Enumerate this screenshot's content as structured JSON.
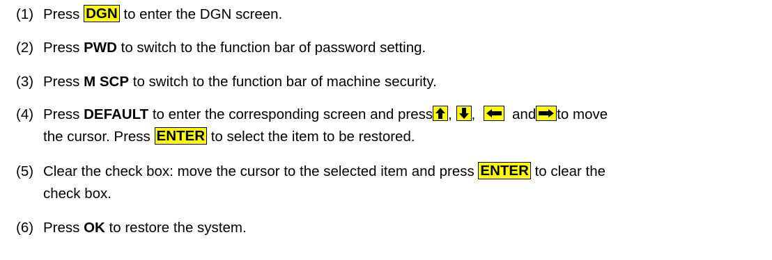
{
  "steps": [
    {
      "num": "(1)",
      "pre": "Press ",
      "key": "DGN",
      "post": " to enter the DGN screen."
    },
    {
      "num": "(2)",
      "pre": "Press ",
      "key": "PWD",
      "post": " to switch to the function bar of password setting."
    },
    {
      "num": "(3)",
      "pre": "Press ",
      "key": "M SCP",
      "post": " to switch to the function bar of machine security."
    },
    {
      "num": "(4)",
      "pre": "Press ",
      "key": "DEFAULT",
      "mid": " to enter the corresponding screen and press",
      "sep1": ",",
      "sep2": ",",
      "and": "and",
      "post": "to move",
      "line2_pre": "the cursor. Press ",
      "line2_key": "ENTER",
      "line2_post": " to select the item to be restored."
    },
    {
      "num": "(5)",
      "pre": "Clear the check box: move the cursor to the selected item and press ",
      "key": "ENTER",
      "post": " to clear the",
      "line2": "check box."
    },
    {
      "num": "(6)",
      "pre": "Press ",
      "key": "OK",
      "post": " to restore the system."
    }
  ],
  "icons": [
    "arrow-up-key-icon",
    "arrow-down-key-icon",
    "arrow-left-key-icon",
    "arrow-right-key-icon"
  ],
  "colors": {
    "key_highlight": "#ffff00",
    "text": "#000000"
  }
}
